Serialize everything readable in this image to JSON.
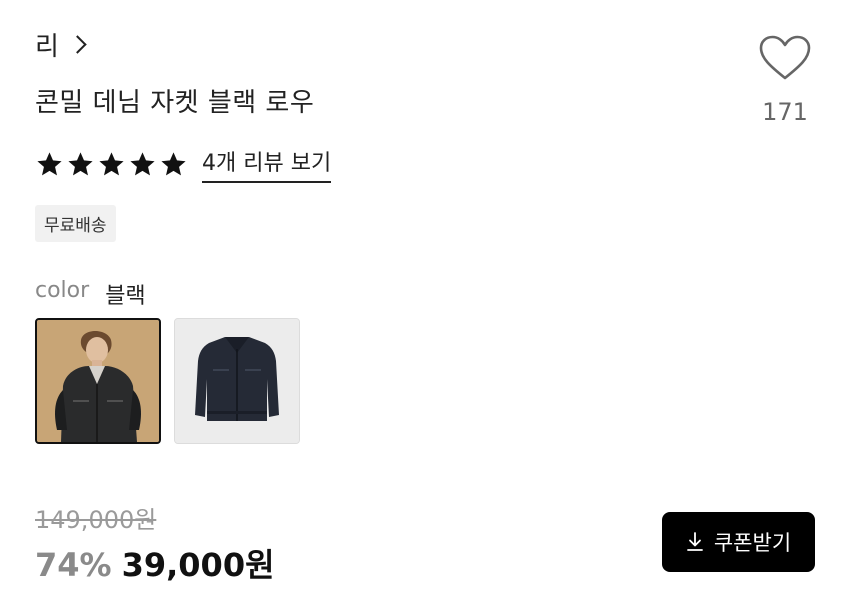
{
  "product": {
    "brand": "리",
    "title": "콘밀 데님 자켓 블랙 로우",
    "like_count": "171",
    "rating_stars": 5,
    "review_link": "4개 리뷰 보기",
    "shipping_badge": "무료배송",
    "color_label": "color",
    "color_value": "블랙",
    "thumbnails": [
      {
        "icon": "model-wearing-jacket-thumbnail",
        "selected": true
      },
      {
        "icon": "jacket-product-thumbnail",
        "selected": false
      }
    ],
    "original_price": "149,000원",
    "discount": "74%",
    "price": "39,000원",
    "coupon_button": "쿠폰받기"
  },
  "colors": {
    "accent": "#000000",
    "muted_text": "#888888",
    "badge_bg": "#f1f1f1"
  }
}
